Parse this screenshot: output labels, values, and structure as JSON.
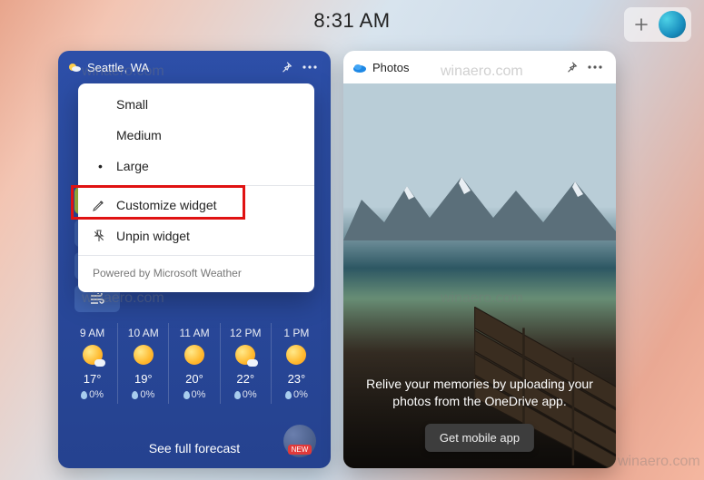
{
  "header": {
    "time": "8:31 AM"
  },
  "weather": {
    "location": "Seattle, WA",
    "forecast_link": "See full forecast",
    "new_badge": "NEW",
    "hourly": [
      {
        "time": "9 AM",
        "temp": "17°",
        "precip": "0%"
      },
      {
        "time": "10 AM",
        "temp": "19°",
        "precip": "0%"
      },
      {
        "time": "11 AM",
        "temp": "20°",
        "precip": "0%"
      },
      {
        "time": "12 PM",
        "temp": "22°",
        "precip": "0%"
      },
      {
        "time": "1 PM",
        "temp": "23°",
        "precip": "0%"
      }
    ]
  },
  "menu": {
    "small": "Small",
    "medium": "Medium",
    "large": "Large",
    "customize": "Customize widget",
    "unpin": "Unpin widget",
    "footer": "Powered by Microsoft Weather"
  },
  "photos": {
    "title": "Photos",
    "caption": "Relive your memories by uploading your photos from the OneDrive app.",
    "cta": "Get mobile app"
  },
  "watermark": "winaero.com"
}
